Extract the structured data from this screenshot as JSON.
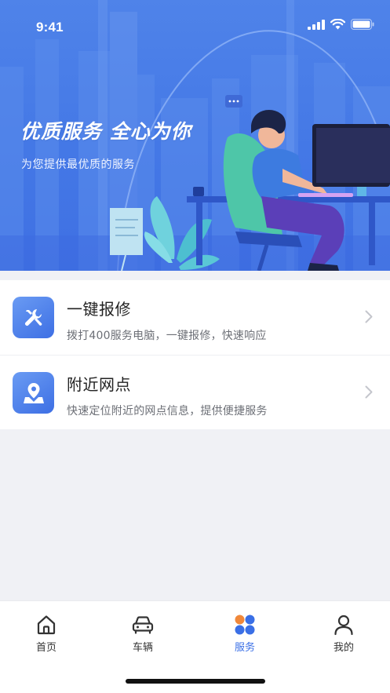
{
  "status_bar": {
    "time": "9:41"
  },
  "banner": {
    "title": "优质服务 全心为你",
    "subtitle": "为您提供最优质的服务"
  },
  "services": [
    {
      "title": "一键报修",
      "description": "拨打400服务电脑，一键报修，快速响应",
      "icon": "repair-tools-icon"
    },
    {
      "title": "附近网点",
      "description": "快速定位附近的网点信息，提供便捷服务",
      "icon": "location-pin-icon"
    }
  ],
  "tab_bar": {
    "tabs": [
      {
        "label": "首页",
        "icon": "home-icon",
        "active": false
      },
      {
        "label": "车辆",
        "icon": "car-icon",
        "active": false
      },
      {
        "label": "服务",
        "icon": "services-grid-icon",
        "active": true
      },
      {
        "label": "我的",
        "icon": "profile-icon",
        "active": false
      }
    ]
  },
  "colors": {
    "accent": "#3a6fe6",
    "banner_blue": "#4478e6",
    "background": "#f0f1f5"
  }
}
